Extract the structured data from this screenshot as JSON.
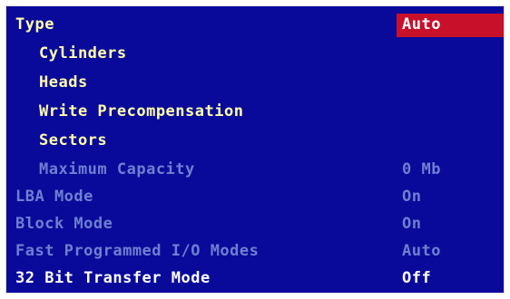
{
  "colors": {
    "background": "#0a0a9a",
    "selected_highlight": "#c8102a",
    "enabled_text": "#ffffa8",
    "disabled_text": "#6f7fd0",
    "white_text": "#ffffff"
  },
  "settings": [
    {
      "label": "Type",
      "value": "Auto",
      "selected": true,
      "enabled": true,
      "indent": 0
    },
    {
      "label": "Cylinders",
      "value": "",
      "enabled": true,
      "indent": 1
    },
    {
      "label": "Heads",
      "value": "",
      "enabled": true,
      "indent": 1
    },
    {
      "label": "Write Precompensation",
      "value": "",
      "enabled": true,
      "indent": 1
    },
    {
      "label": "Sectors",
      "value": "",
      "enabled": true,
      "indent": 1
    },
    {
      "label": "Maximum Capacity",
      "value": "0 Mb",
      "enabled": false,
      "indent": 1
    },
    {
      "label": "LBA Mode",
      "value": "On",
      "enabled": false,
      "indent": 0
    },
    {
      "label": "Block Mode",
      "value": "On",
      "enabled": false,
      "indent": 0
    },
    {
      "label": "Fast Programmed I/O Modes",
      "value": "Auto",
      "enabled": false,
      "indent": 0
    },
    {
      "label": "32 Bit Transfer Mode",
      "value": "Off",
      "enabled": true,
      "indent": 0
    }
  ]
}
